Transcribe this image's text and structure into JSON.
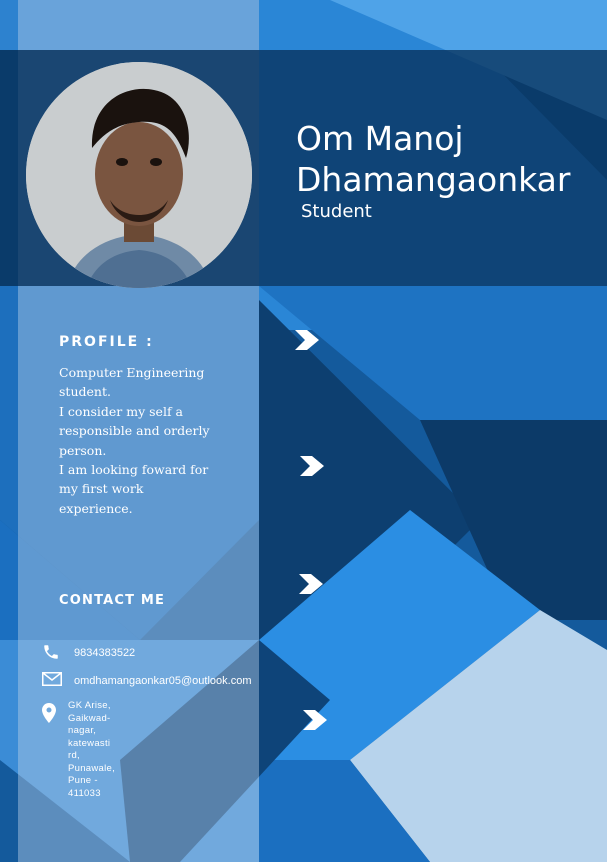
{
  "header": {
    "name": "Om Manoj\nDhamangaonkar",
    "role": "Student"
  },
  "profile": {
    "title": "PROFILE :",
    "text": "Computer Engineering\nstudent.\nI consider my self a\nresponsible and orderly\nperson.\nI am looking foward for\nmy first work\nexperience."
  },
  "contact": {
    "title": "CONTACT ME",
    "phone": "9834383522",
    "email": "omdhamangaonkar05@outlook.com",
    "address": "GK Arise, Gaikwad-nagar,\nkatewasti rd, Punawale,\nPune - 411033"
  },
  "icons": {
    "phone": "phone-icon",
    "email": "mail-icon",
    "address": "location-pin-icon",
    "chevrons": "chevron-right-icon"
  },
  "colors": {
    "dark_blue": "#0b3a66",
    "mid_blue": "#1e6fc0",
    "bright_blue": "#2e8fe0",
    "light_blue": "#a9c9e6",
    "text": "#ffffff"
  }
}
